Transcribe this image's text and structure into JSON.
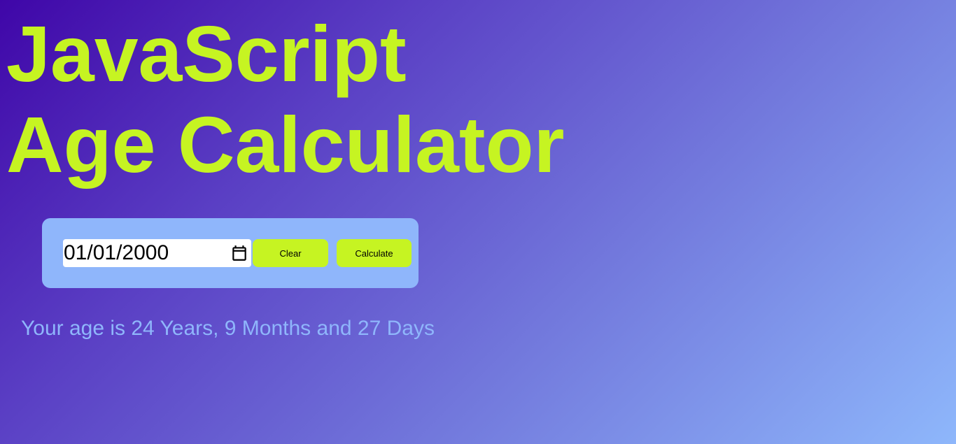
{
  "header": {
    "title_line1": "JavaScript",
    "title_line2": "Age Calculator"
  },
  "form": {
    "date_value": "01/01/2000",
    "calendar_icon": "calendar-icon",
    "clear_label": "Clear",
    "calculate_label": "Calculate"
  },
  "result": {
    "text": "Your age is 24 Years, 9 Months and 27 Days"
  },
  "colors": {
    "accent": "#c6f422",
    "panel": "#8fb6fb",
    "result_text": "#8fb6fb",
    "gradient_start": "#3f06a8",
    "gradient_end": "#8eb7fb"
  }
}
